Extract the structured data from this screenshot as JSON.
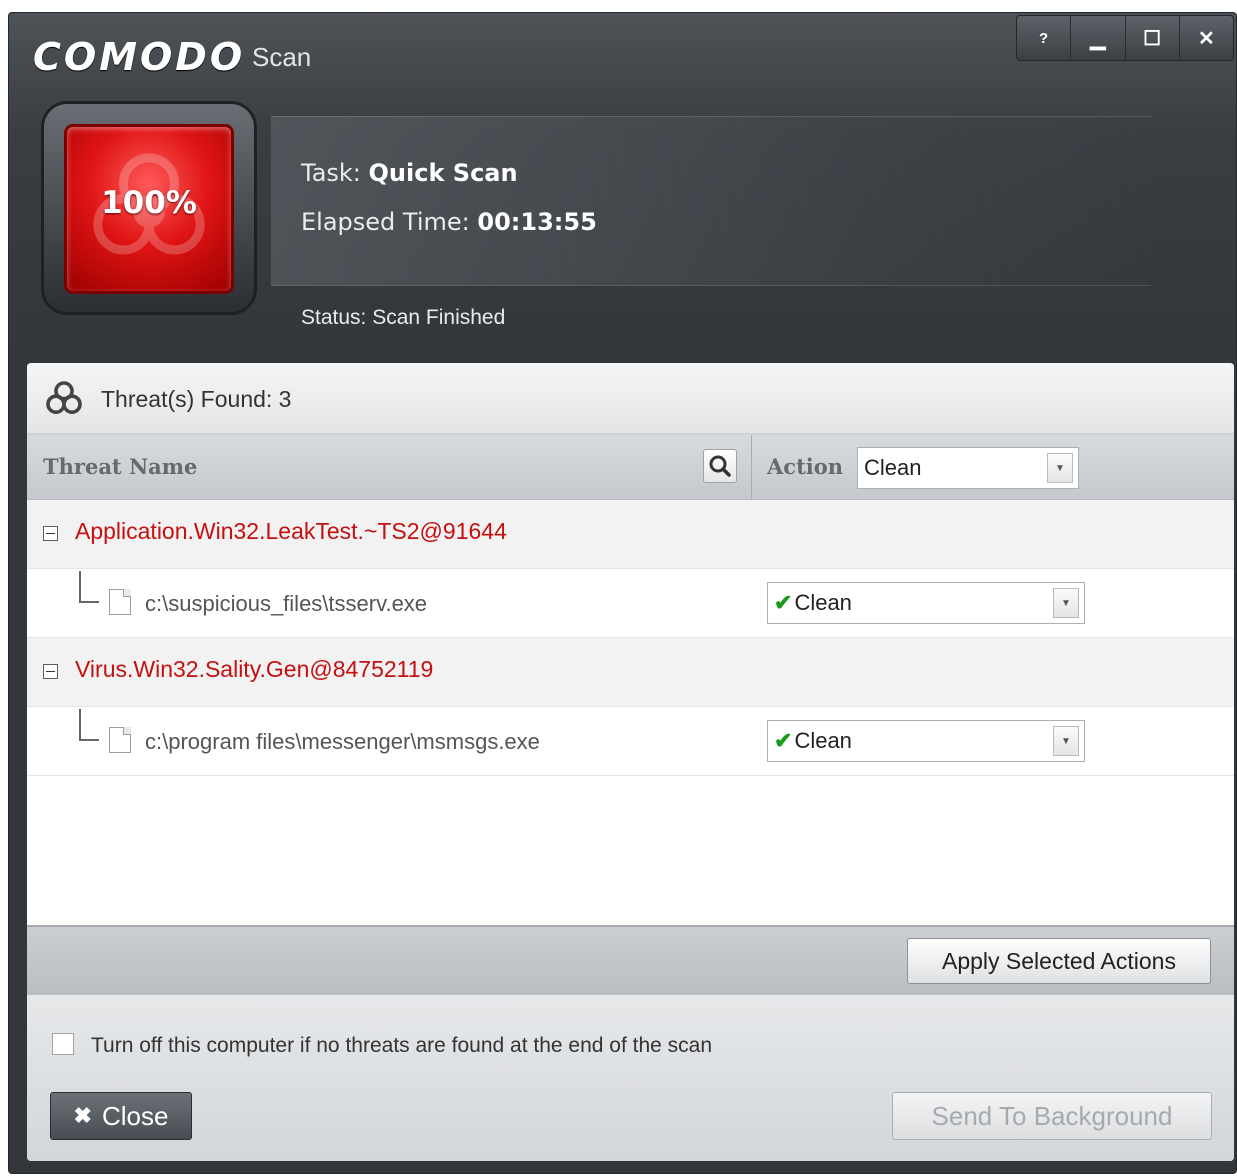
{
  "window": {
    "brand": "COMODO",
    "subtitle": "Scan",
    "controls": {
      "help": "?",
      "minimize": "▁",
      "maximize": "☐",
      "close": "✕"
    }
  },
  "progress": {
    "percent_label": "100%",
    "percent_value": 100,
    "icon": "biohazard-icon"
  },
  "task": {
    "task_label": "Task:",
    "task_value": "Quick Scan",
    "elapsed_label": "Elapsed Time:",
    "elapsed_value": "00:13:55",
    "status": "Status: Scan Finished"
  },
  "results": {
    "found_label": "Threat(s) Found: 3",
    "columns": {
      "threat": "Threat Name",
      "action": "Action"
    },
    "global_action": "Clean",
    "threats": [
      {
        "name": "Application.Win32.LeakTest.~TS2@91644",
        "file": "c:\\suspicious_files\\tsserv.exe",
        "action": "Clean"
      },
      {
        "name": "Virus.Win32.Sality.Gen@84752119",
        "file": "c:\\program files\\messenger\\msmsgs.exe",
        "action": "Clean"
      }
    ],
    "apply_button": "Apply Selected Actions"
  },
  "footer": {
    "shutdown_label": "Turn off this computer if no threats are found at the end of the scan",
    "shutdown_checked": false,
    "close_button": "Close",
    "background_button": "Send To Background"
  },
  "colors": {
    "threat_text": "#c41010",
    "badge_red": "#e01414",
    "check_green": "#1a9a1a"
  }
}
